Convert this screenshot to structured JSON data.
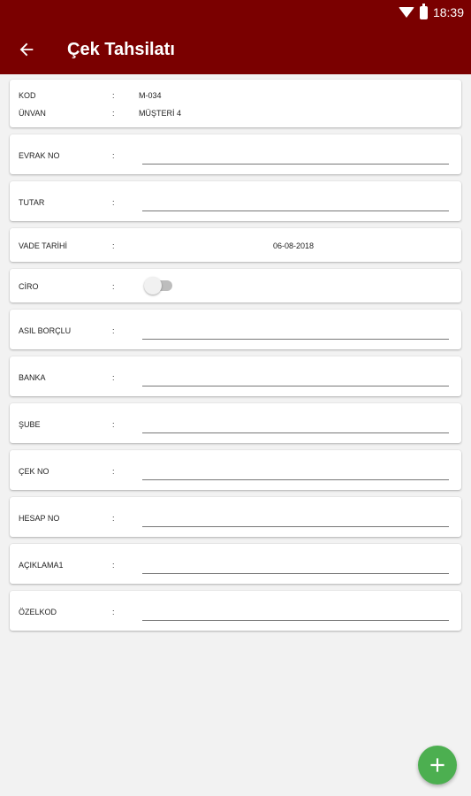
{
  "status_bar": {
    "time": "18:39",
    "wifi_icon": "wifi-icon",
    "battery_icon": "battery-icon"
  },
  "toolbar": {
    "title": "Çek Tahsilatı",
    "back_icon": "arrow-left-icon",
    "color": "#7a0000"
  },
  "header": {
    "rows": [
      {
        "label": "KOD",
        "colon": ":",
        "value": "M-034"
      },
      {
        "label": "ÜNVAN",
        "colon": ":",
        "value": "MÜŞTERİ 4"
      }
    ]
  },
  "fields": {
    "evrak_no": {
      "label": "EVRAK NO",
      "colon": ":",
      "value": ""
    },
    "tutar": {
      "label": "TUTAR",
      "colon": ":",
      "value": ""
    },
    "vade_tarihi": {
      "label": "VADE TARİHİ",
      "colon": ":",
      "value": "06-08-2018"
    },
    "ciro": {
      "label": "CİRO",
      "colon": ":",
      "enabled": false
    },
    "asil_borclu": {
      "label": "ASIL BORÇLU",
      "colon": ":",
      "value": ""
    },
    "banka": {
      "label": "BANKA",
      "colon": ":",
      "value": ""
    },
    "sube": {
      "label": "ŞUBE",
      "colon": ":",
      "value": ""
    },
    "cek_no": {
      "label": "ÇEK NO",
      "colon": ":",
      "value": ""
    },
    "hesap_no": {
      "label": "HESAP NO",
      "colon": ":",
      "value": ""
    },
    "aciklama1": {
      "label": "AÇIKLAMA1",
      "colon": ":",
      "value": ""
    },
    "ozel_kod": {
      "label": "ÖZELKOD",
      "colon": ":",
      "value": ""
    }
  },
  "fab": {
    "icon": "plus-icon",
    "color": "#4caf50"
  }
}
